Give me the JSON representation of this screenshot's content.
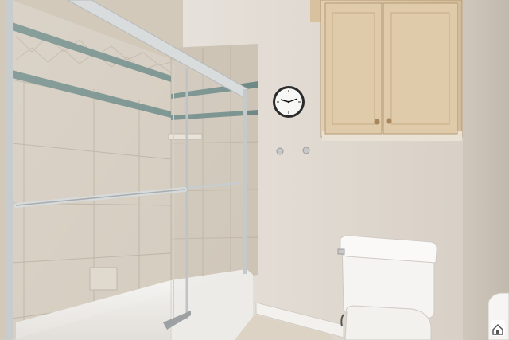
{
  "scene": {
    "colors": {
      "wall": "#e3ddd5",
      "wall_shadow": "#c9c1b6",
      "tile": "#cfc6b8",
      "tile_accent": "#6f8a86",
      "cabinet": "#d9c4a5",
      "cabinet_edge": "#b59a74",
      "tub": "#f4f3f0",
      "toilet": "#f5f4f2",
      "floor": "#ddd3c4",
      "glass_frame": "#c9cccd",
      "clock_face": "#f7f7f5",
      "clock_rim": "#2a2a2a"
    },
    "objects": [
      "tiled-shower",
      "glass-sliding-door",
      "towel-bar",
      "bathtub",
      "wall-clock",
      "wall-cabinet",
      "robe-hooks",
      "toilet",
      "baseboard",
      "watermark-icon"
    ]
  }
}
